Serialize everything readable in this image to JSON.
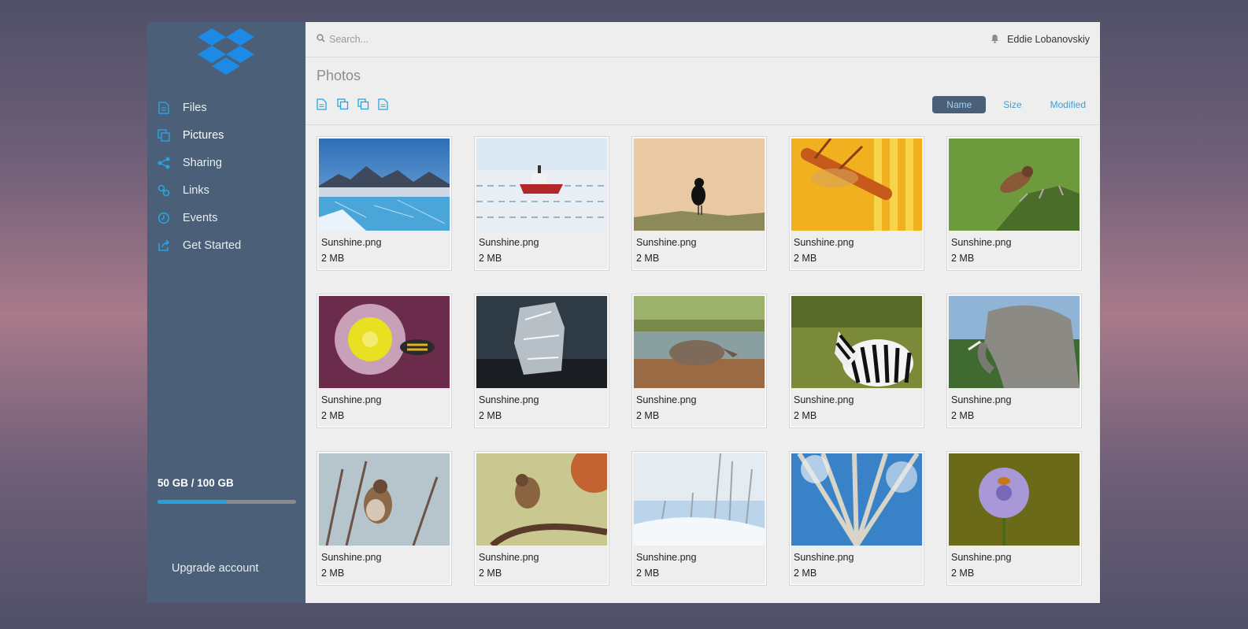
{
  "brand": {
    "logo": "dropbox-logo",
    "color": "#1d8ae6"
  },
  "sidebar": {
    "items": [
      {
        "label": "Files",
        "icon": "file-icon"
      },
      {
        "label": "Pictures",
        "icon": "pictures-icon",
        "active": true
      },
      {
        "label": "Sharing",
        "icon": "share-icon"
      },
      {
        "label": "Links",
        "icon": "link-icon"
      },
      {
        "label": "Events",
        "icon": "clock-icon"
      },
      {
        "label": "Get Started",
        "icon": "external-share-icon"
      }
    ],
    "storage": {
      "text": "50 GB / 100 GB",
      "used_fraction": 0.5
    },
    "upgrade_label": "Upgrade account"
  },
  "topbar": {
    "search_placeholder": "Search...",
    "user_name": "Eddie Lobanovskiy"
  },
  "page": {
    "title": "Photos",
    "sort": {
      "name": "Name",
      "size": "Size",
      "modified": "Modified",
      "active": "Name"
    }
  },
  "photos": [
    {
      "name": "Sunshine.png",
      "size": "2 MB",
      "subject": "glacier"
    },
    {
      "name": "Sunshine.png",
      "size": "2 MB",
      "subject": "icebreaker"
    },
    {
      "name": "Sunshine.png",
      "size": "2 MB",
      "subject": "blackbird"
    },
    {
      "name": "Sunshine.png",
      "size": "2 MB",
      "subject": "hoverfly"
    },
    {
      "name": "Sunshine.png",
      "size": "2 MB",
      "subject": "robber-fly"
    },
    {
      "name": "Sunshine.png",
      "size": "2 MB",
      "subject": "flower-bee"
    },
    {
      "name": "Sunshine.png",
      "size": "2 MB",
      "subject": "ice-block"
    },
    {
      "name": "Sunshine.png",
      "size": "2 MB",
      "subject": "rhino"
    },
    {
      "name": "Sunshine.png",
      "size": "2 MB",
      "subject": "zebra"
    },
    {
      "name": "Sunshine.png",
      "size": "2 MB",
      "subject": "elephant"
    },
    {
      "name": "Sunshine.png",
      "size": "2 MB",
      "subject": "sparrow-branch"
    },
    {
      "name": "Sunshine.png",
      "size": "2 MB",
      "subject": "sparrow-autumn"
    },
    {
      "name": "Sunshine.png",
      "size": "2 MB",
      "subject": "snow-plants"
    },
    {
      "name": "Sunshine.png",
      "size": "2 MB",
      "subject": "birch-trees"
    },
    {
      "name": "Sunshine.png",
      "size": "2 MB",
      "subject": "purple-flower"
    }
  ]
}
